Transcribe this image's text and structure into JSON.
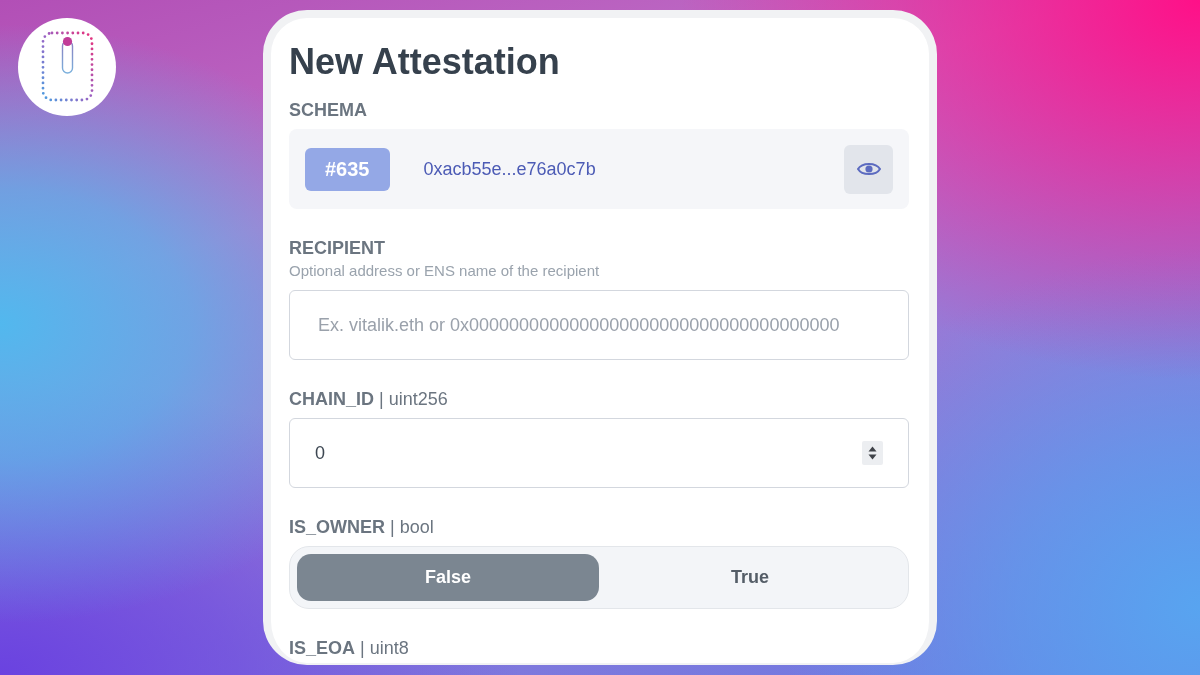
{
  "form": {
    "title": "New Attestation",
    "schema": {
      "label": "SCHEMA",
      "badge": "#635",
      "uid": "0xacb55e...e76a0c7b"
    },
    "fields": [
      {
        "kind": "text",
        "label": "RECIPIENT",
        "hint": "Optional address or ENS name of the recipient",
        "placeholder": "Ex. vitalik.eth or 0x0000000000000000000000000000000000000"
      },
      {
        "kind": "number",
        "label": "**CHAIN_ID** | uint256",
        "value": "0"
      },
      {
        "kind": "toggle",
        "label": "**IS_OWNER** | bool",
        "options": [
          {
            "label": "False",
            "selected": true
          },
          {
            "label": "True",
            "selected": false
          }
        ]
      },
      {
        "kind": "label",
        "label": "**IS_EOA** | uint8"
      }
    ]
  }
}
